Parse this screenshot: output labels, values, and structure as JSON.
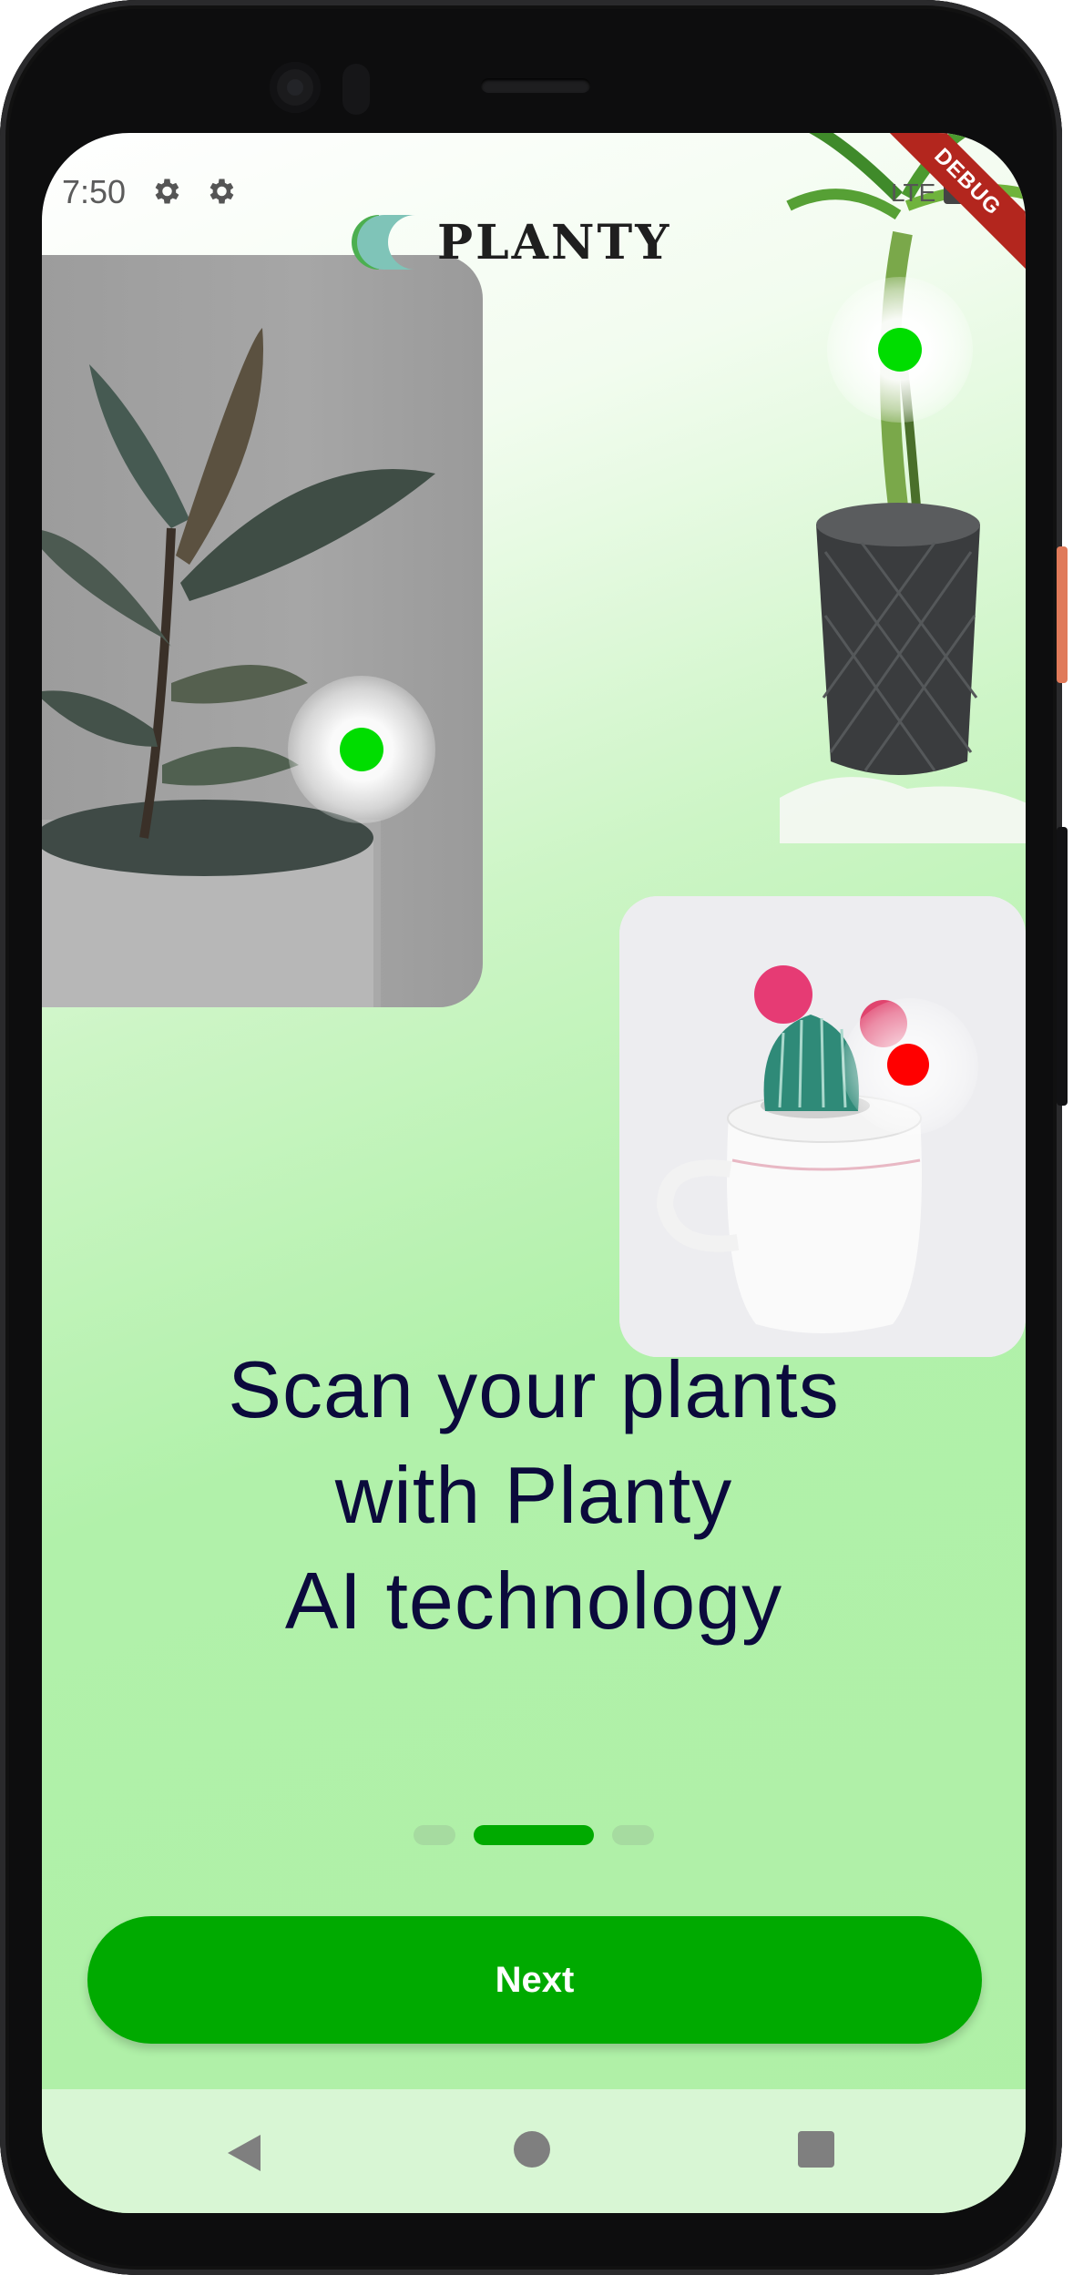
{
  "status_bar": {
    "time": "7:50",
    "icons": [
      "settings-gear-icon",
      "settings-gear-icon"
    ],
    "network": "LTE"
  },
  "app": {
    "logo_text": "PLANTY",
    "debug_banner": "DEBUG"
  },
  "onboarding": {
    "headline_lines": [
      "Scan your plants",
      "with Planty",
      "AI technology"
    ],
    "page_indicator": {
      "pages": 3,
      "active_index": 1
    },
    "next_label": "Next",
    "scan_markers": [
      {
        "image": "rubber-plant",
        "status": "healthy",
        "color": "#00dd00"
      },
      {
        "image": "dracaena-plant",
        "status": "healthy",
        "color": "#00dd00"
      },
      {
        "image": "cactus",
        "status": "issue",
        "color": "#ff0000"
      }
    ]
  },
  "colors": {
    "accent": "#00aa00",
    "headline": "#0b0a3c",
    "indicator_active": "#00aa00",
    "indicator_inactive": "#a6dba0",
    "navbar_bg": "#d8f6d4"
  },
  "system_nav": [
    "back-icon",
    "home-icon",
    "recents-icon"
  ]
}
